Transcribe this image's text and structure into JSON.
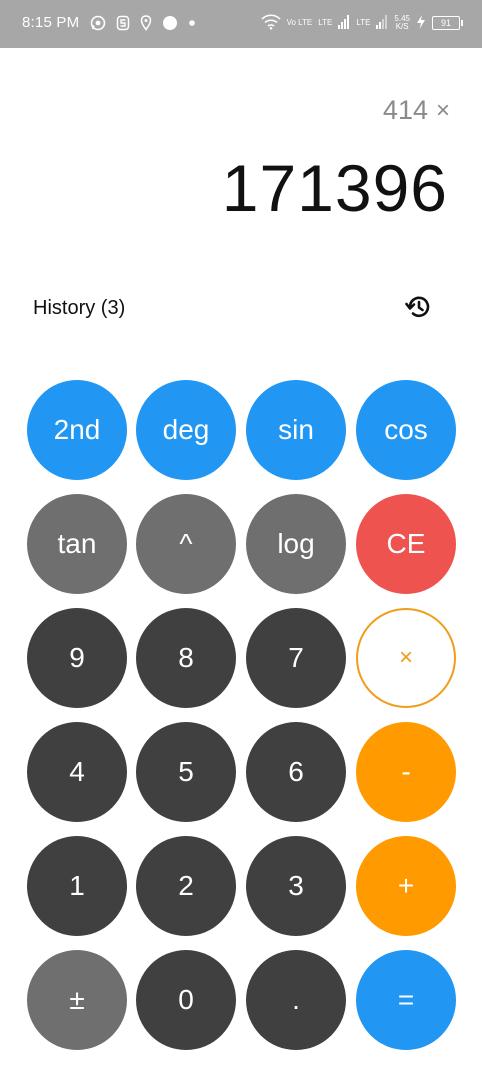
{
  "status_bar": {
    "time": "8:15 PM",
    "left_icons": [
      "whatsapp-icon",
      "s-app-icon",
      "location-icon",
      "record-icon",
      "dot-icon"
    ],
    "volte_label": "Vo LTE",
    "lte1_label": "LTE",
    "lte2_label": "LTE",
    "speed_value": "5.45",
    "speed_unit": "K/S",
    "battery_level": "91"
  },
  "display": {
    "expression_value": "414",
    "expression_operator": "×",
    "result": "171396"
  },
  "history": {
    "label": "History (3)",
    "icon": "history-icon"
  },
  "keys": [
    {
      "id": "2nd",
      "label": "2nd",
      "style": "blue"
    },
    {
      "id": "deg",
      "label": "deg",
      "style": "blue"
    },
    {
      "id": "sin",
      "label": "sin",
      "style": "blue"
    },
    {
      "id": "cos",
      "label": "cos",
      "style": "blue"
    },
    {
      "id": "tan",
      "label": "tan",
      "style": "grey"
    },
    {
      "id": "power",
      "label": "^",
      "style": "grey"
    },
    {
      "id": "log",
      "label": "log",
      "style": "grey"
    },
    {
      "id": "ce",
      "label": "CE",
      "style": "red"
    },
    {
      "id": "9",
      "label": "9",
      "style": "dark"
    },
    {
      "id": "8",
      "label": "8",
      "style": "dark"
    },
    {
      "id": "7",
      "label": "7",
      "style": "dark"
    },
    {
      "id": "multiply",
      "label": "×",
      "style": "outline"
    },
    {
      "id": "4",
      "label": "4",
      "style": "dark"
    },
    {
      "id": "5",
      "label": "5",
      "style": "dark"
    },
    {
      "id": "6",
      "label": "6",
      "style": "dark"
    },
    {
      "id": "minus",
      "label": "-",
      "style": "orange"
    },
    {
      "id": "1",
      "label": "1",
      "style": "dark"
    },
    {
      "id": "2",
      "label": "2",
      "style": "dark"
    },
    {
      "id": "3",
      "label": "3",
      "style": "dark"
    },
    {
      "id": "plus",
      "label": "+",
      "style": "orange"
    },
    {
      "id": "plusminus",
      "label": "±",
      "style": "grey"
    },
    {
      "id": "0",
      "label": "0",
      "style": "dark"
    },
    {
      "id": "dot",
      "label": ".",
      "style": "dark"
    },
    {
      "id": "equals",
      "label": "=",
      "style": "blue"
    }
  ],
  "colors": {
    "blue": "#2196f3",
    "grey": "#6f6f6f",
    "dark": "#404040",
    "red": "#ee5350",
    "orange": "#ff9a00",
    "outline_orange": "#f09d1a",
    "status_bar": "#a7a7a7"
  }
}
